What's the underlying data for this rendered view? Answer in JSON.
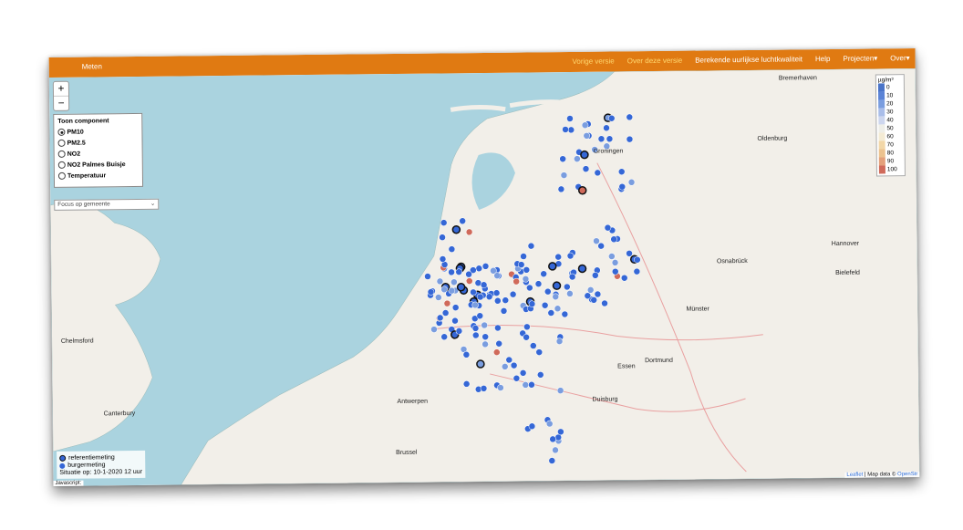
{
  "navbar": {
    "brand": "Meten",
    "items": [
      "Vorige versie",
      "Over deze versie",
      "Berekende uurlijkse luchtkwaliteit",
      "Help",
      "Projecten▾",
      "Over▾"
    ]
  },
  "zoom": {
    "in": "+",
    "out": "−"
  },
  "component_panel": {
    "title": "Toon component",
    "options": [
      "PM10",
      "PM2.5",
      "NO2",
      "NO2 Palmes Buisje",
      "Temperatuur"
    ],
    "selected": "PM10"
  },
  "gemeente_select": {
    "value": "Focus op gemeente"
  },
  "legend": {
    "unit": "µg/m³",
    "levels": [
      {
        "label": "0",
        "color": "#4a74c8"
      },
      {
        "label": "10",
        "color": "#5b83d6"
      },
      {
        "label": "20",
        "color": "#7a9ddf"
      },
      {
        "label": "30",
        "color": "#a9bde9"
      },
      {
        "label": "40",
        "color": "#cdd6ee"
      },
      {
        "label": "50",
        "color": "#eeeee8"
      },
      {
        "label": "60",
        "color": "#f4ebd4"
      },
      {
        "label": "70",
        "color": "#f2d7a8"
      },
      {
        "label": "80",
        "color": "#ecc28e"
      },
      {
        "label": "90",
        "color": "#e4a07a"
      },
      {
        "label": "100",
        "color": "#d06a5a"
      }
    ]
  },
  "footer_legend": {
    "ref": "referentiemeting",
    "burger": "burgermeting",
    "situatie": "Situatie op: 10-1-2020 12 uur"
  },
  "javascript_label": "Javascript:",
  "attribution": {
    "leaflet": "Leaflet",
    "sep": " | Map data © ",
    "osm": "OpenStr"
  },
  "map_labels": [
    "Hannover",
    "Dortmund",
    "Antwerpen",
    "Brussel",
    "Essen",
    "Duisburg",
    "Groningen",
    "Oldenburg",
    "Bremerhaven",
    "Osnabrück",
    "Münster",
    "Bielefeld",
    "Canterbury",
    "Chelmsford"
  ],
  "colors": {
    "navbar": "#e07a12",
    "sea": "#aad3df",
    "land": "#f2efe9",
    "point": "#3567d6"
  }
}
